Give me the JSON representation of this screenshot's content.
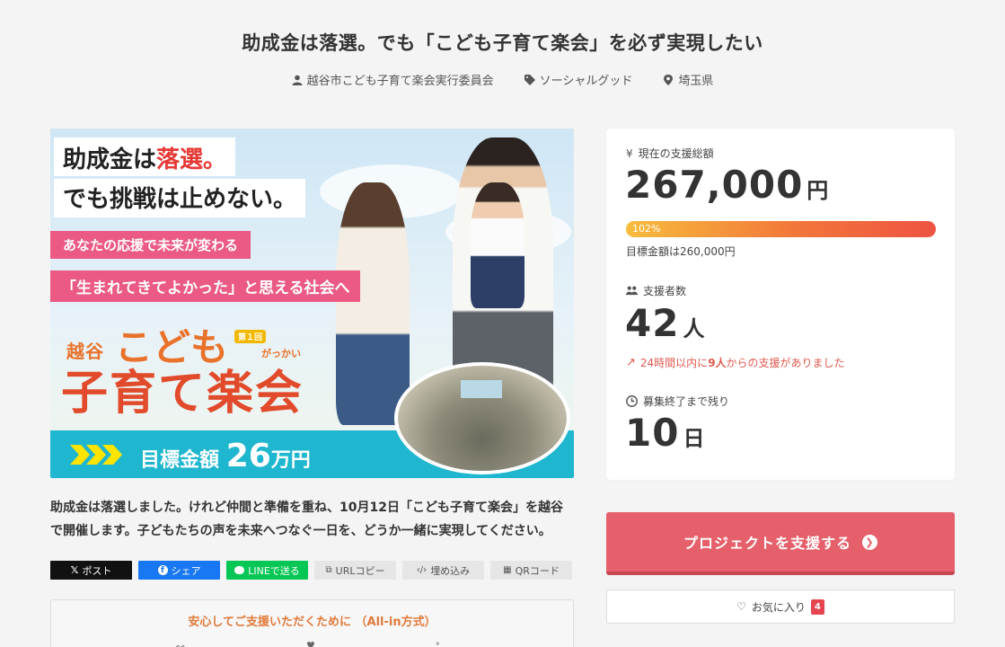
{
  "project": {
    "title": "助成金は落選。でも「こども子育て楽会」を必ず実現したい",
    "owner": "越谷市こども子育て楽会実行委員会",
    "category": "ソーシャルグッド",
    "location": "埼玉県",
    "description": "助成金は落選しました。けれど仲間と準備を重ね、10月12日「こども子育て楽会」を越谷で開催します。子どもたちの声を未来へつなぐ一日を、どうか一緒に実現してください。"
  },
  "hero": {
    "line1_a": "助成金は",
    "line1_b": "落選。",
    "line2": "でも挑戦は止めない。",
    "pink1": "あなたの応援で未来が変わる",
    "pink2": "「生まれてきてよかった」と思える社会へ",
    "logo_city": "越谷",
    "logo_kodomo": "こども",
    "logo_badge": "第１回",
    "logo_ruby": "がっかい",
    "logo_main": "子育て楽会",
    "goal_prefix": "目標金額",
    "goal_number": "26",
    "goal_suffix": "万円"
  },
  "stats": {
    "total_label": "現在の支援総額",
    "total_value": "267,000",
    "total_unit": "円",
    "progress_label": "102%",
    "progress_percent": 102,
    "target_text": "目標金額は260,000円",
    "supporters_label": "支援者数",
    "supporters_value": "42",
    "supporters_unit": "人",
    "trend_prefix": "24時間以内に",
    "trend_count": "9人",
    "trend_suffix": "からの支援がありました",
    "remaining_label": "募集終了まで残り",
    "remaining_value": "10",
    "remaining_unit": "日"
  },
  "actions": {
    "support_label": "プロジェクトを支援する",
    "favorite_label": "お気に入り",
    "favorite_count": "4"
  },
  "share": {
    "x": "ポスト",
    "facebook": "シェア",
    "line": "LINEで送る",
    "url": "URLコピー",
    "embed": "埋め込み",
    "qr": "QRコード"
  },
  "safe": {
    "title": "安心してご支援いただくために （All-in方式）"
  },
  "colors": {
    "accent": "#e5606a",
    "progress_start": "#f7bc3c",
    "progress_end": "#ee5342",
    "trend": "#e05a4f"
  }
}
